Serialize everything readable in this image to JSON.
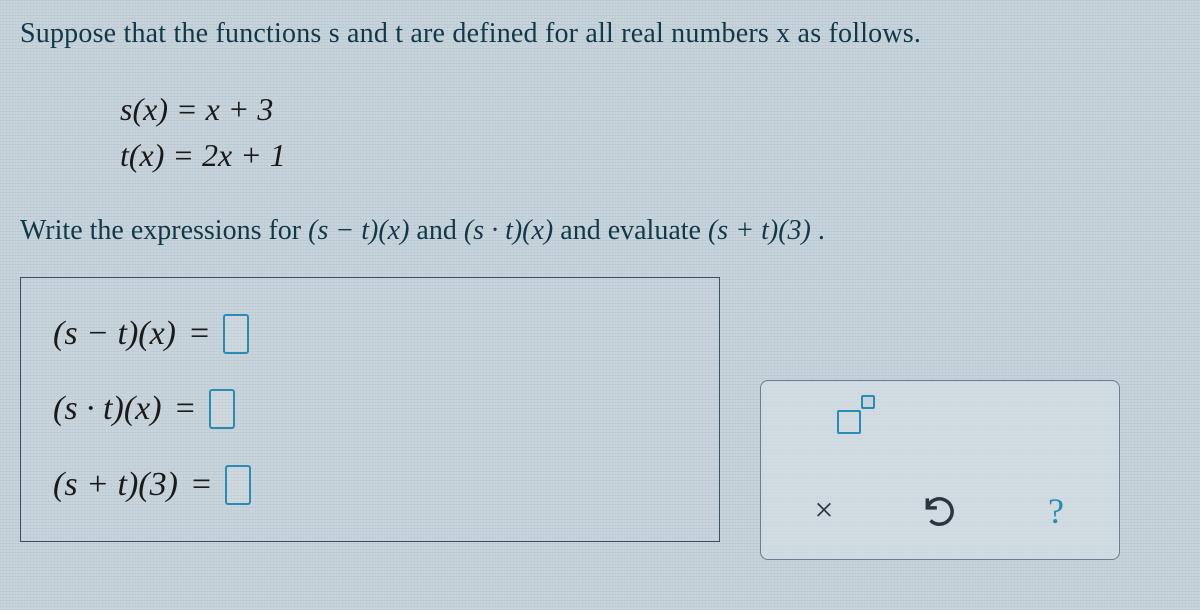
{
  "prompt": {
    "intro": "Suppose that the functions s and t are defined for all real numbers x as follows."
  },
  "definitions": {
    "s": "s(x) = x + 3",
    "t": "t(x) = 2x + 1"
  },
  "ask": {
    "prefix": "Write the expressions for ",
    "expr1": "(s − t)(x)",
    "mid1": " and ",
    "expr2": "(s · t)(x)",
    "mid2": " and evaluate ",
    "expr3": "(s + t)(3)",
    "suffix": "."
  },
  "answers": {
    "row1_lhs": "(s − t)(x)",
    "row2_lhs": "(s · t)(x)",
    "row3_lhs": "(s + t)(3)",
    "eq": "="
  },
  "tools": {
    "exponent": "exponent",
    "clear": "×",
    "undo": "undo",
    "help": "?"
  }
}
